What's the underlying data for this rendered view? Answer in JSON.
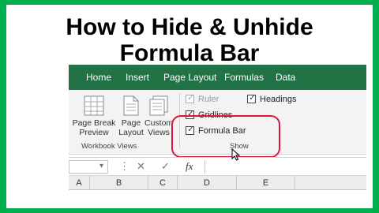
{
  "title": {
    "line1": "How to Hide & Unhide",
    "line2": "Formula Bar"
  },
  "ribbon_tabs": [
    "Home",
    "Insert",
    "Page Layout",
    "Formulas",
    "Data"
  ],
  "workbook_views": {
    "buttons": [
      {
        "line1": "Page Break",
        "line2": "Preview",
        "icon": "page-break-preview-icon"
      },
      {
        "line1": "Page",
        "line2": "Layout",
        "icon": "page-layout-icon"
      },
      {
        "line1": "Custom",
        "line2": "Views",
        "icon": "custom-views-icon"
      }
    ],
    "group_label": "Workbook Views"
  },
  "show": {
    "ruler": {
      "label": "Ruler",
      "checked": true,
      "disabled": true
    },
    "headings": {
      "label": "Headings",
      "checked": true
    },
    "gridlines": {
      "label": "Gridlines",
      "checked": true
    },
    "formula_bar": {
      "label": "Formula Bar",
      "checked": true
    },
    "group_label": "Show",
    "check_glyph": "✓"
  },
  "formula_bar": {
    "dropdown_glyph": "▾",
    "more_glyph": "⋮",
    "cancel_glyph": "✕",
    "enter_glyph": "✓",
    "fx_label": "fx"
  },
  "columns": [
    "A",
    "B",
    "C",
    "D",
    "E"
  ],
  "colors": {
    "border_green": "#00b04f",
    "ribbon_green": "#217346",
    "highlight_red": "#e0153f"
  }
}
